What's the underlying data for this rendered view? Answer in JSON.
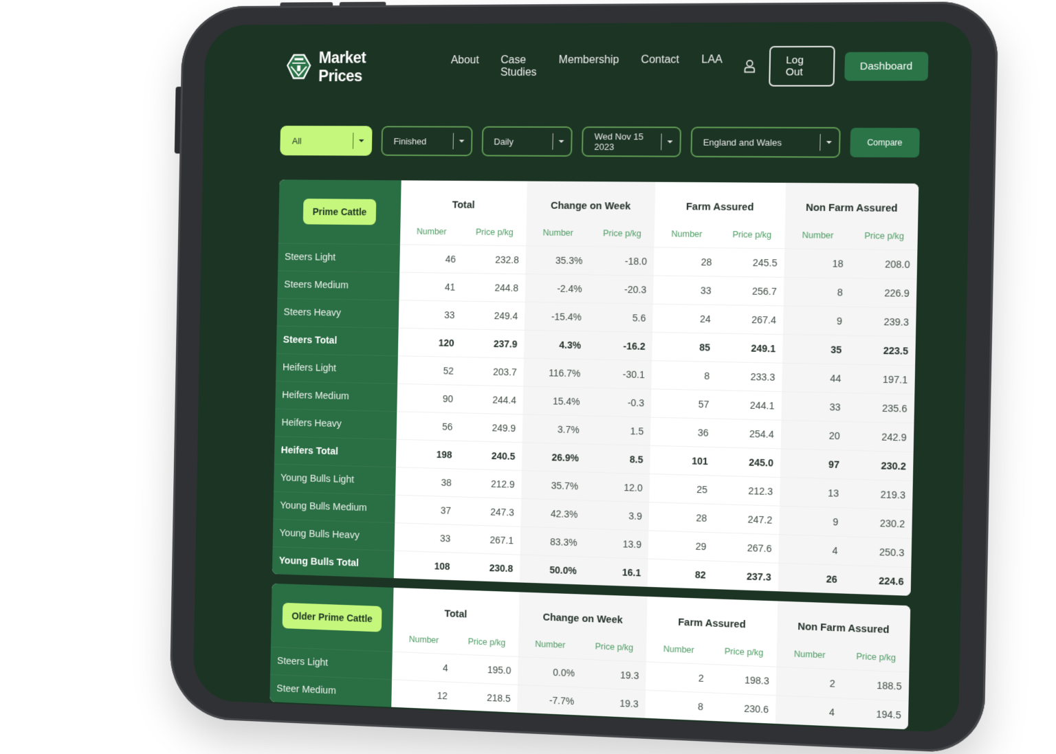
{
  "header": {
    "brand": "Market Prices",
    "nav_links": [
      "About",
      "Case Studies",
      "Membership",
      "Contact",
      "LAA"
    ],
    "logout_label": "Log Out",
    "dashboard_label": "Dashboard"
  },
  "filters": {
    "category": "All",
    "type": "Finished",
    "frequency": "Daily",
    "date": "Wed Nov 15 2023",
    "region": "England and Wales",
    "compare_label": "Compare"
  },
  "column_groups": [
    "Total",
    "Change on Week",
    "Farm Assured",
    "Non Farm Assured"
  ],
  "sub_headers": [
    "Number",
    "Price p/kg"
  ],
  "tables": [
    {
      "title": "Prime Cattle",
      "rows": [
        {
          "label": "Steers Light",
          "total": false,
          "values": [
            "46",
            "232.8",
            "35.3%",
            "-18.0",
            "28",
            "245.5",
            "18",
            "208.0"
          ]
        },
        {
          "label": "Steers Medium",
          "total": false,
          "values": [
            "41",
            "244.8",
            "-2.4%",
            "-20.3",
            "33",
            "256.7",
            "8",
            "226.9"
          ]
        },
        {
          "label": "Steers Heavy",
          "total": false,
          "values": [
            "33",
            "249.4",
            "-15.4%",
            "5.6",
            "24",
            "267.4",
            "9",
            "239.3"
          ]
        },
        {
          "label": "Steers Total",
          "total": true,
          "values": [
            "120",
            "237.9",
            "4.3%",
            "-16.2",
            "85",
            "249.1",
            "35",
            "223.5"
          ]
        },
        {
          "label": "Heifers Light",
          "total": false,
          "values": [
            "52",
            "203.7",
            "116.7%",
            "-30.1",
            "8",
            "233.3",
            "44",
            "197.1"
          ]
        },
        {
          "label": "Heifers Medium",
          "total": false,
          "values": [
            "90",
            "244.4",
            "15.4%",
            "-0.3",
            "57",
            "244.1",
            "33",
            "235.6"
          ]
        },
        {
          "label": "Heifers Heavy",
          "total": false,
          "values": [
            "56",
            "249.9",
            "3.7%",
            "1.5",
            "36",
            "254.4",
            "20",
            "242.9"
          ]
        },
        {
          "label": "Heifers Total",
          "total": true,
          "values": [
            "198",
            "240.5",
            "26.9%",
            "8.5",
            "101",
            "245.0",
            "97",
            "230.2"
          ]
        },
        {
          "label": "Young Bulls Light",
          "total": false,
          "values": [
            "38",
            "212.9",
            "35.7%",
            "12.0",
            "25",
            "212.3",
            "13",
            "219.3"
          ]
        },
        {
          "label": "Young Bulls Medium",
          "total": false,
          "values": [
            "37",
            "247.3",
            "42.3%",
            "3.9",
            "28",
            "247.2",
            "9",
            "230.2"
          ]
        },
        {
          "label": "Young Bulls Heavy",
          "total": false,
          "values": [
            "33",
            "267.1",
            "83.3%",
            "13.9",
            "29",
            "267.6",
            "4",
            "250.3"
          ]
        },
        {
          "label": "Young Bulls Total",
          "total": true,
          "values": [
            "108",
            "230.8",
            "50.0%",
            "16.1",
            "82",
            "237.3",
            "26",
            "224.6"
          ]
        }
      ]
    },
    {
      "title": "Older Prime Cattle",
      "rows": [
        {
          "label": "Steers Light",
          "total": false,
          "values": [
            "4",
            "195.0",
            "0.0%",
            "19.3",
            "2",
            "198.3",
            "2",
            "188.5"
          ]
        },
        {
          "label": "Steer Medium",
          "total": false,
          "values": [
            "12",
            "218.5",
            "-7.7%",
            "19.3",
            "8",
            "230.6",
            "4",
            "194.5"
          ]
        }
      ]
    }
  ]
}
